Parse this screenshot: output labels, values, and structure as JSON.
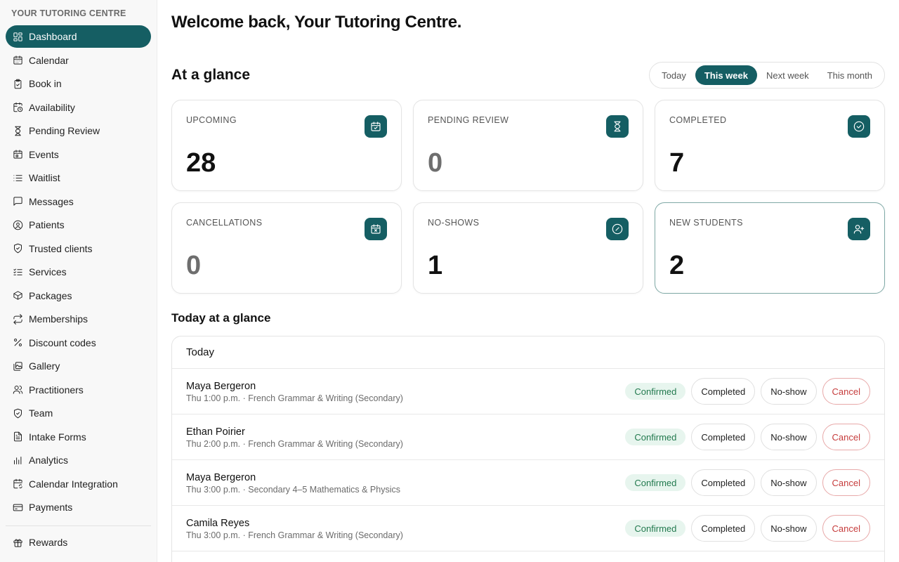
{
  "sidebar": {
    "org_name": "YOUR TUTORING CENTRE",
    "items": [
      {
        "label": "Dashboard",
        "icon": "dashboard-grid-icon",
        "active": true
      },
      {
        "label": "Calendar",
        "icon": "calendar-icon"
      },
      {
        "label": "Book in",
        "icon": "clipboard-icon"
      },
      {
        "label": "Availability",
        "icon": "calendar-clock-icon"
      },
      {
        "label": "Pending Review",
        "icon": "hourglass-icon"
      },
      {
        "label": "Events",
        "icon": "calendar-event-icon"
      },
      {
        "label": "Waitlist",
        "icon": "list-icon"
      },
      {
        "label": "Messages",
        "icon": "message-icon"
      },
      {
        "label": "Patients",
        "icon": "user-circle-icon"
      },
      {
        "label": "Trusted clients",
        "icon": "shield-check-icon"
      },
      {
        "label": "Services",
        "icon": "list-check-icon"
      },
      {
        "label": "Packages",
        "icon": "package-icon"
      },
      {
        "label": "Memberships",
        "icon": "repeat-icon"
      },
      {
        "label": "Discount codes",
        "icon": "percent-icon"
      },
      {
        "label": "Gallery",
        "icon": "gallery-icon"
      },
      {
        "label": "Practitioners",
        "icon": "users-icon"
      },
      {
        "label": "Team",
        "icon": "shield-icon"
      },
      {
        "label": "Intake Forms",
        "icon": "document-icon"
      },
      {
        "label": "Analytics",
        "icon": "bar-chart-icon"
      },
      {
        "label": "Calendar Integration",
        "icon": "calendar-sync-icon"
      },
      {
        "label": "Payments",
        "icon": "credit-card-icon"
      }
    ],
    "bottom_items": [
      {
        "label": "Rewards",
        "icon": "gift-icon"
      }
    ]
  },
  "header": {
    "welcome": "Welcome back, Your Tutoring Centre."
  },
  "glance": {
    "title": "At a glance",
    "range_tabs": [
      {
        "label": "Today",
        "active": false
      },
      {
        "label": "This week",
        "active": true
      },
      {
        "label": "Next week",
        "active": false
      },
      {
        "label": "This month",
        "active": false
      }
    ],
    "cards": [
      {
        "label": "UPCOMING",
        "value": "28",
        "icon": "calendar-check-icon",
        "muted": false
      },
      {
        "label": "PENDING REVIEW",
        "value": "0",
        "icon": "hourglass-icon",
        "muted": true
      },
      {
        "label": "COMPLETED",
        "value": "7",
        "icon": "check-circle-icon",
        "muted": false
      },
      {
        "label": "CANCELLATIONS",
        "value": "0",
        "icon": "calendar-x-icon",
        "muted": true
      },
      {
        "label": "NO-SHOWS",
        "value": "1",
        "icon": "slash-circle-icon",
        "muted": false
      },
      {
        "label": "NEW STUDENTS",
        "value": "2",
        "icon": "user-plus-icon",
        "muted": false,
        "highlight": true
      }
    ]
  },
  "today": {
    "title": "Today at a glance",
    "panel_header": "Today",
    "actions": {
      "status": "Confirmed",
      "completed": "Completed",
      "no_show": "No-show",
      "cancel": "Cancel"
    },
    "appointments": [
      {
        "name": "Maya Bergeron",
        "detail": "Thu 1:00 p.m. · French Grammar & Writing (Secondary)"
      },
      {
        "name": "Ethan Poirier",
        "detail": "Thu 2:00 p.m. · French Grammar & Writing (Secondary)"
      },
      {
        "name": "Maya Bergeron",
        "detail": "Thu 3:00 p.m. · Secondary 4–5 Mathematics & Physics"
      },
      {
        "name": "Camila Reyes",
        "detail": "Thu 3:00 p.m. · French Grammar & Writing (Secondary)"
      }
    ]
  },
  "colors": {
    "accent": "#155e63",
    "confirmed_bg": "#e7f5ee",
    "confirmed_text": "#237a4f",
    "cancel": "#c63c3c"
  }
}
